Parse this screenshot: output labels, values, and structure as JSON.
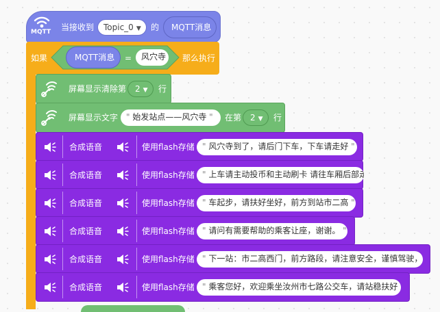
{
  "colors": {
    "mqtt_event": "#7b84e8",
    "control": "#f6ad1a",
    "sensing": "#5a91e8",
    "display": "#71be73",
    "voice": "#8a2be2"
  },
  "hat": {
    "icon": "wifi-icon",
    "icon_caption": "MQTT",
    "label_when": "当接收到",
    "topic_value": "Topic_0",
    "label_of": "的",
    "message_reporter": "MQTT消息"
  },
  "if_block": {
    "label_if": "如果",
    "left_reporter": "MQTT消息",
    "operator": "=",
    "right_value": "风穴寺",
    "label_then": "那么执行"
  },
  "clear_line": {
    "icon": "screen-display-icon",
    "label": "屏幕显示清除第",
    "line_value": "2",
    "suffix": "行"
  },
  "show_text": {
    "icon": "screen-display-icon",
    "label": "屏幕显示文字",
    "text_value": "始发站点——风穴寺",
    "at_label": "在第",
    "line_value": "2",
    "suffix": "行"
  },
  "tts_blocks": [
    {
      "label": "合成语音",
      "flash_label": "使用flash存储",
      "text": "风穴寺到了，请后门下车，下车请走好"
    },
    {
      "label": "合成语音",
      "flash_label": "使用flash存储",
      "text": "上车请主动投币和主动刷卡 请往车厢后部走"
    },
    {
      "label": "合成语音",
      "flash_label": "使用flash存储",
      "text": "车起步，请扶好坐好，前方到站市二高"
    },
    {
      "label": "合成语音",
      "flash_label": "使用flash存储",
      "text": "请问有需要帮助的乘客让座，谢谢。"
    },
    {
      "label": "合成语音",
      "flash_label": "使用flash存储",
      "text": "下一站：市二高西门，前方路段，请注意安全，谨慎驾驶，"
    },
    {
      "label": "合成语音",
      "flash_label": "使用flash存储",
      "text": "乘客您好，欢迎乘坐汝州市七路公交车，请站稳扶好"
    }
  ]
}
